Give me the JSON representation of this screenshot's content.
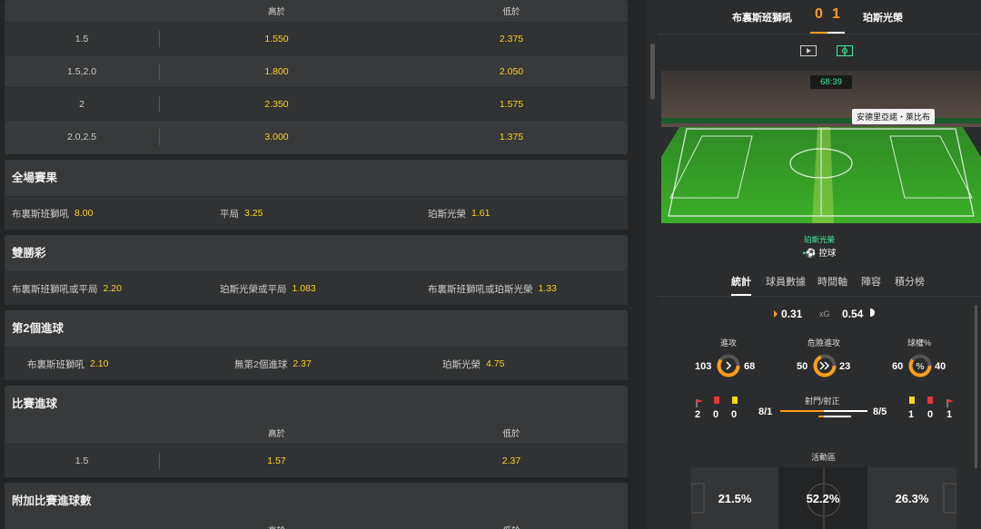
{
  "market1": {
    "header": {
      "over": "高於",
      "under": "低於"
    },
    "rows": [
      {
        "line": "1.5",
        "over": "1.550",
        "under": "2.375"
      },
      {
        "line": "1.5,2.0",
        "over": "1.800",
        "under": "2.050"
      },
      {
        "line": "2",
        "over": "2.350",
        "under": "1.575"
      },
      {
        "line": "2.0,2.5",
        "over": "3.000",
        "under": "1.375"
      }
    ]
  },
  "full_time": {
    "title": "全場賽果",
    "selections": [
      {
        "label": "布裏斯班獅吼",
        "odds": "8.00"
      },
      {
        "label": "平局",
        "odds": "3.25"
      },
      {
        "label": "珀斯光榮",
        "odds": "1.61"
      }
    ]
  },
  "double_chance": {
    "title": "雙勝彩",
    "selections": [
      {
        "label": "布裏斯班獅吼或平局",
        "odds": "2.20"
      },
      {
        "label": "珀斯光榮或平局",
        "odds": "1.083"
      },
      {
        "label": "布裏斯班獅吼或珀斯光榮",
        "odds": "1.33"
      }
    ]
  },
  "second_goal": {
    "title": "第2個進球",
    "selections": [
      {
        "label": "布裏斯班獅吼",
        "odds": "2.10"
      },
      {
        "label": "無第2個進球",
        "odds": "2.37"
      },
      {
        "label": "珀斯光榮",
        "odds": "4.75"
      }
    ]
  },
  "match_goals": {
    "title": "比賽進球",
    "header": {
      "over": "高於",
      "under": "低於"
    },
    "rows": [
      {
        "line": "1.5",
        "over": "1.57",
        "under": "2.37"
      }
    ]
  },
  "extra_goals": {
    "title": "附加比賽進球數",
    "header": {
      "over": "高於",
      "under": "低於"
    }
  },
  "match": {
    "home": "布裏斯班獅吼",
    "away": "珀斯光榮",
    "home_score": "0",
    "away_score": "1",
    "clock": "68:39",
    "callout": "安德里亞諾・萊比布",
    "possession_team": "珀斯光榮",
    "possession_label": "控球"
  },
  "tabs": [
    "統計",
    "球員數據",
    "時間軸",
    "陣容",
    "積分榜"
  ],
  "stats": {
    "xg_label": "xG",
    "home_xg": "0.31",
    "away_xg": "0.54",
    "attacks": {
      "label": "進攻",
      "home": "103",
      "away": "68"
    },
    "dangerous": {
      "label": "危險進攻",
      "home": "50",
      "away": "23"
    },
    "possession": {
      "label": "球權%",
      "home": "60",
      "away": "40"
    },
    "shots": {
      "label": "射門/射正",
      "home": "8/1",
      "away": "8/5"
    },
    "home_cards": {
      "corners": "2",
      "red": "0",
      "yellow": "0"
    },
    "away_cards": {
      "yellow": "1",
      "red": "0",
      "corners": "1"
    },
    "zones_label": "活動區",
    "zones": [
      "21.5%",
      "52.2%",
      "26.3%"
    ]
  },
  "colors": {
    "odds": "#ffd21f",
    "accent": "#ff9d1c",
    "green": "#3bf0a0"
  }
}
